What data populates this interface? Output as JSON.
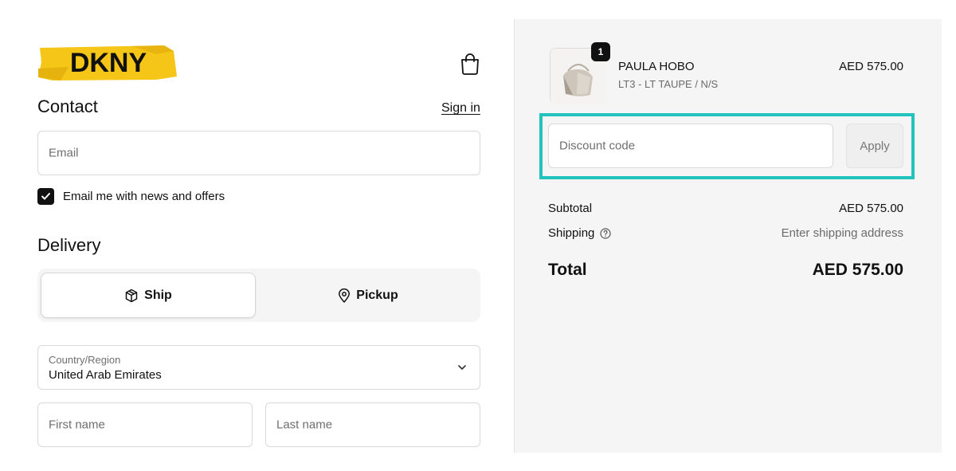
{
  "brand": {
    "logo_text": "DKNY",
    "logo_color": "#f5c518"
  },
  "contact": {
    "heading": "Contact",
    "signin_label": "Sign in",
    "email_placeholder": "Email",
    "newsletter_label": "Email me with news and offers",
    "newsletter_checked": true
  },
  "delivery": {
    "heading": "Delivery",
    "options": [
      {
        "label": "Ship",
        "icon": "package-icon",
        "selected": true
      },
      {
        "label": "Pickup",
        "icon": "map-pin-icon",
        "selected": false
      }
    ],
    "country_label": "Country/Region",
    "country_value": "United Arab Emirates",
    "first_name_placeholder": "First name",
    "last_name_placeholder": "Last name"
  },
  "summary": {
    "item": {
      "name": "PAULA HOBO",
      "variant": "LT3 - LT TAUPE / N/S",
      "price": "AED 575.00",
      "quantity": "1"
    },
    "discount_placeholder": "Discount code",
    "apply_label": "Apply",
    "subtotal_label": "Subtotal",
    "subtotal_value": "AED 575.00",
    "shipping_label": "Shipping",
    "shipping_value": "Enter shipping address",
    "total_label": "Total",
    "total_value": "AED 575.00"
  },
  "colors": {
    "highlight": "#22c3bd",
    "panel_bg": "#f5f5f5"
  }
}
